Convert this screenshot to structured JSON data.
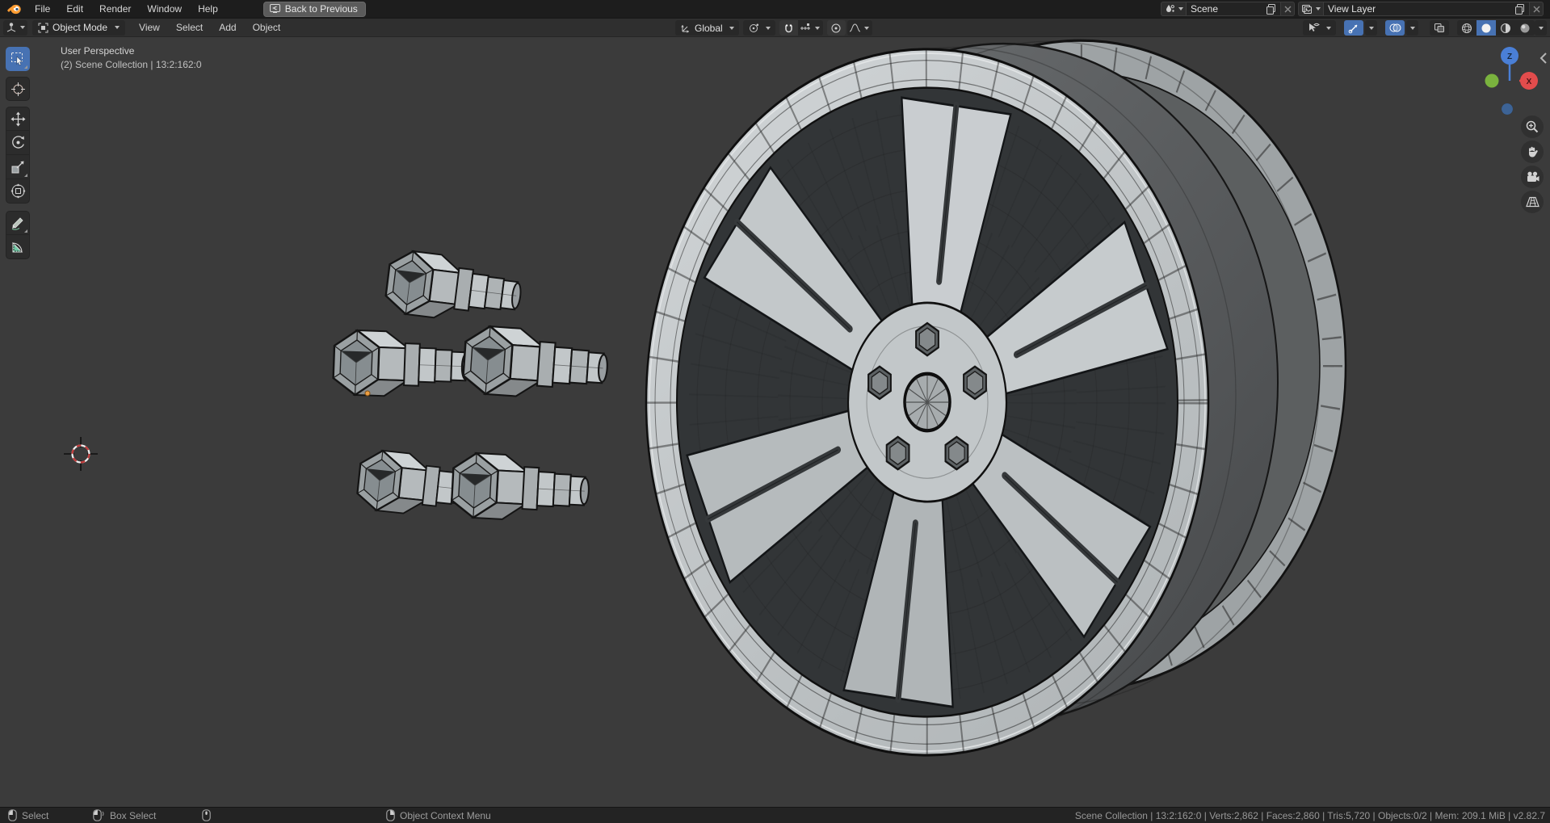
{
  "app": {
    "name": "Blender"
  },
  "topbar": {
    "menus": [
      {
        "label": "File"
      },
      {
        "label": "Edit"
      },
      {
        "label": "Render"
      },
      {
        "label": "Window"
      },
      {
        "label": "Help"
      }
    ],
    "back_button": "Back to Previous",
    "scene_field": {
      "value": "Scene"
    },
    "view_layer_field": {
      "value": "View Layer"
    }
  },
  "viewport_header": {
    "mode": "Object Mode",
    "menus": [
      {
        "label": "View"
      },
      {
        "label": "Select"
      },
      {
        "label": "Add"
      },
      {
        "label": "Object"
      }
    ],
    "orientation": "Global"
  },
  "tool_shelf": {
    "active_tool": "select-box",
    "tools": [
      "select-box",
      "cursor",
      "move",
      "rotate",
      "scale",
      "transform",
      "annotate",
      "measure"
    ]
  },
  "viewport": {
    "overlay": {
      "line1": "User Perspective",
      "line2": "(2) Scene Collection | 13:2:162:0"
    },
    "axis_gizmo": {
      "z_label": "Z",
      "x_label": "X"
    }
  },
  "statusbar": {
    "hints": [
      {
        "label": "Select"
      },
      {
        "label": "Box Select"
      },
      {
        "label": ""
      },
      {
        "label": "Object Context Menu"
      }
    ],
    "stats": "Scene Collection | 13:2:162:0 | Verts:2,862 | Faces:2,860 | Tris:5,720 | Objects:0/2 | Mem: 209.1 MiB | v2.82.7",
    "stats_parts": {
      "collection": "Scene Collection",
      "path": "13:2:162:0",
      "verts": "2,862",
      "faces": "2,860",
      "tris": "5,720",
      "objects": "0/2",
      "memory": "209.1 MiB",
      "version": "v2.82.7"
    }
  },
  "colors": {
    "accent": "#4772b3",
    "viewport_bg": "#3b3b3b",
    "topbar_bg": "#1d1d1d",
    "header_bg": "#2f2f2f",
    "statusbar_bg": "#232323",
    "mesh_light": "#c6cbcd",
    "mesh_recess": "#323537",
    "axis_x": "#e24c4c",
    "axis_y": "#7ab33e",
    "axis_z": "#4a7fd6",
    "origin_dot": "#ed9e42"
  }
}
